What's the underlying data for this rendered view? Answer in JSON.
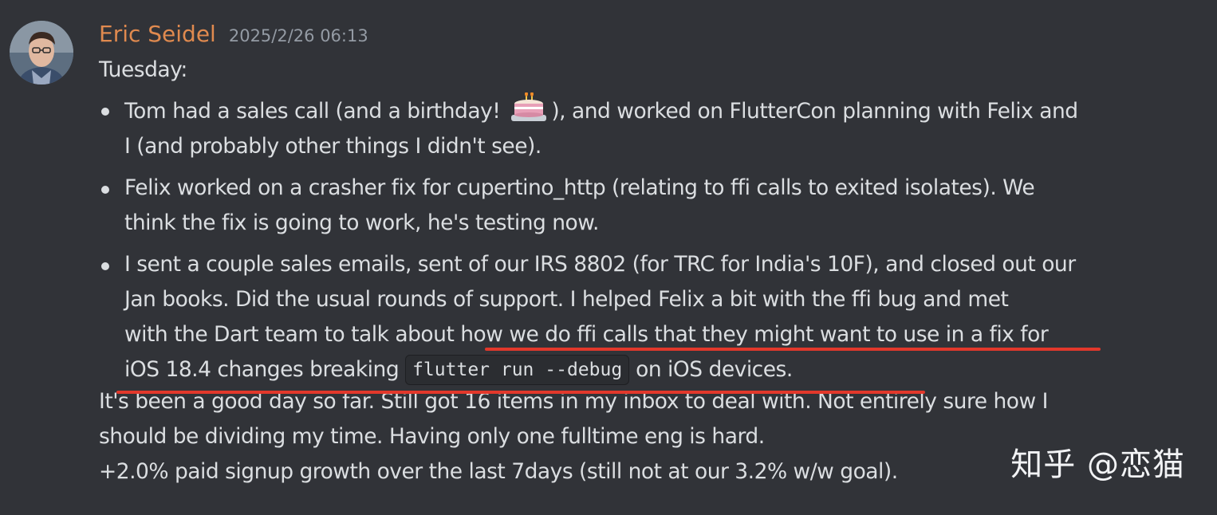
{
  "message": {
    "author": "Eric Seidel",
    "timestamp": "2025/2/26 06:13",
    "author_color": "#e08a4f",
    "intro": "Tuesday:",
    "bullets": [
      {
        "line1_before": "Tom had a sales call (and a birthday! ",
        "emoji": "birthday-cake-icon",
        "line1_after": "), and worked on FlutterCon planning with Felix and",
        "line2": "I (and probably other things I didn't see)."
      },
      {
        "line1": "Felix worked on a crasher fix for cupertino_http (relating to ffi calls to exited isolates).  We",
        "line2": "think the fix is going to work, he's testing now."
      },
      {
        "line1": "I sent a couple sales emails, sent of our IRS 8802 (for TRC for India's 10F), and closed out our",
        "line2": "Jan books.  Did the usual rounds of support.  I helped Felix a bit with the ffi bug and met",
        "line3": "with the Dart team to talk about how we do ffi calls that they might want to use in a fix for",
        "line4_before": "iOS 18.4 changes breaking ",
        "code": "flutter run --debug",
        "line4_after": " on iOS devices."
      }
    ],
    "outro": [
      "It's been a good day so far.  Still got 16 items in my inbox to deal with.  Not entirely sure how I",
      "should be dividing my time.  Having only one fulltime eng is hard.",
      "+2.0% paid signup growth over the last 7days (still not at our 3.2% w/w goal)."
    ]
  },
  "annotation_color": "#e2382b",
  "watermark": "知乎 @恋猫"
}
